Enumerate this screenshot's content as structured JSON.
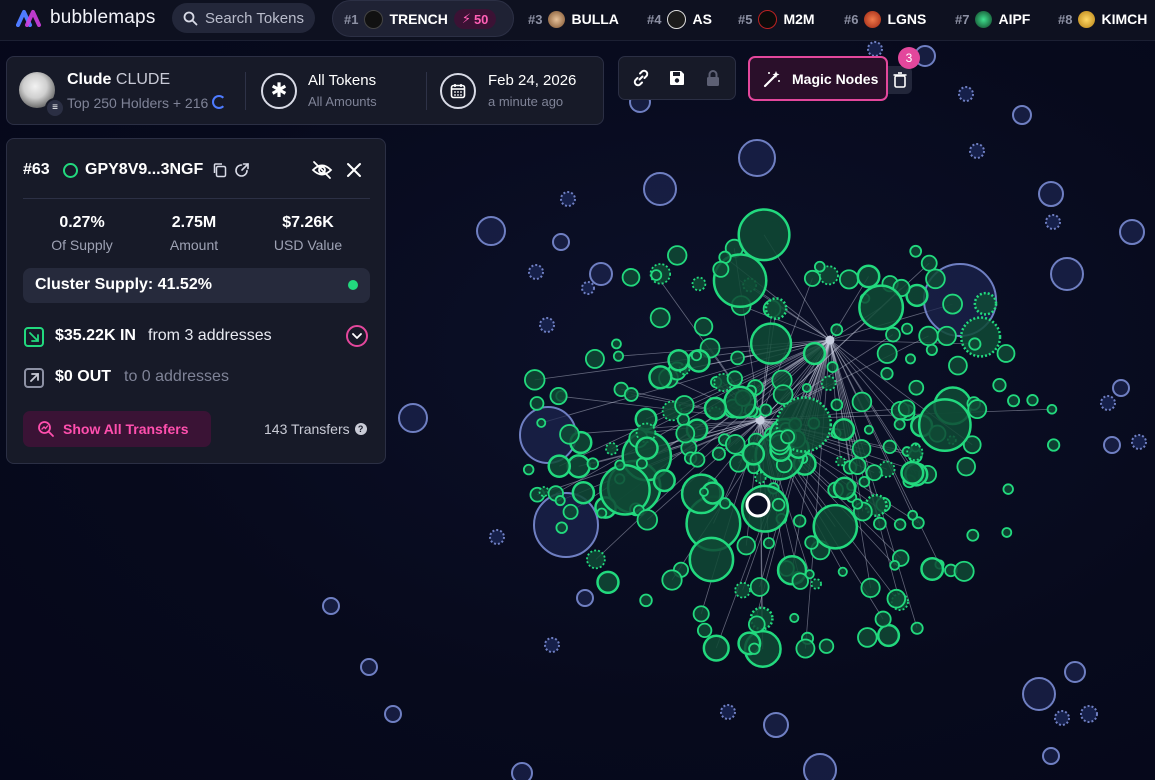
{
  "brand": {
    "name": "bubblemaps"
  },
  "search": {
    "label": "Search Tokens"
  },
  "trending": [
    {
      "rank": "#1",
      "symbol": "TRENCH",
      "boost": "50",
      "icon_color": "#111111",
      "icon_text": "TRENCH"
    },
    {
      "rank": "#3",
      "symbol": "BULLA",
      "icon_color": "#c9a27a",
      "icon_text": ""
    },
    {
      "rank": "#4",
      "symbol": "AS",
      "icon_color": "#1b1b1b",
      "icon_text": ""
    },
    {
      "rank": "#5",
      "symbol": "M2M",
      "icon_color": "#0b0b0b",
      "icon_text": "M2M"
    },
    {
      "rank": "#6",
      "symbol": "LGNS",
      "icon_color": "#c2361d",
      "icon_text": ""
    },
    {
      "rank": "#7",
      "symbol": "AIPF",
      "icon_color": "#0f3d24",
      "icon_text": ""
    },
    {
      "rank": "#8",
      "symbol": "KIMCH",
      "icon_color": "#d8a72f",
      "icon_text": ""
    }
  ],
  "token": {
    "name": "Clude",
    "ticker": "CLUDE",
    "holders": "Top 250 Holders + 216",
    "filter_title": "All Tokens",
    "filter_sub": "All Amounts",
    "date_title": "Feb 24, 2026",
    "date_sub": "a minute ago"
  },
  "toolbar": {
    "magic_label": "Magic Nodes",
    "magic_count": "3"
  },
  "wallet": {
    "rank": "#63",
    "address": "GPY8V9...3NGF",
    "stats": [
      {
        "value": "0.27%",
        "label": "Of Supply"
      },
      {
        "value": "2.75M",
        "label": "Amount"
      },
      {
        "value": "$7.26K",
        "label": "USD Value"
      }
    ],
    "cluster_supply": "Cluster Supply: 41.52%",
    "in_amount": "$35.22K IN",
    "in_desc": "from 3 addresses",
    "out_amount": "$0 OUT",
    "out_desc": "to 0 addresses",
    "show_transfers": "Show All Transfers",
    "transfers_count": "143 Transfers"
  },
  "colors": {
    "accent": "#e3479c",
    "green": "#22d97e",
    "inactive_bubble": "#6f7fc2",
    "panel": "#171a28"
  }
}
